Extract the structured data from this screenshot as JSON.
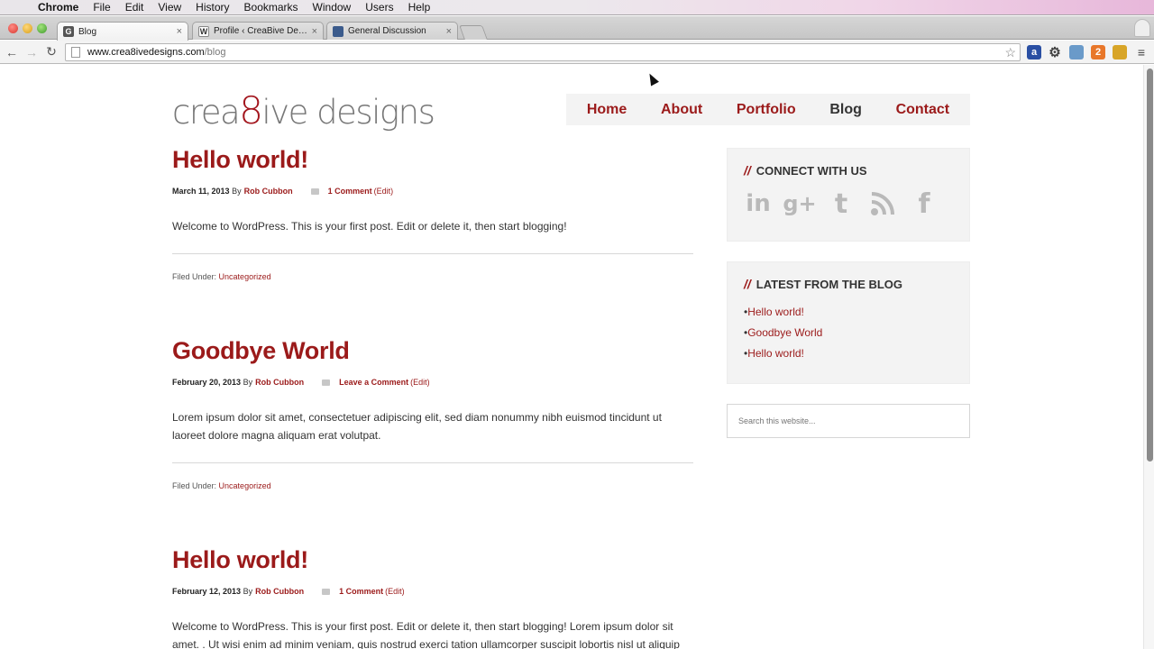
{
  "menubar": {
    "app": "Chrome",
    "items": [
      "File",
      "Edit",
      "View",
      "History",
      "Bookmarks",
      "Window",
      "Users",
      "Help"
    ]
  },
  "tabs": [
    {
      "label": "Blog",
      "favicon": "G",
      "active": true
    },
    {
      "label": "Profile ‹ CreaBive Designs",
      "favicon": "W",
      "active": false
    },
    {
      "label": "General Discussion",
      "favicon": "",
      "active": false
    }
  ],
  "address": {
    "host": "www.crea8ivedesigns.com",
    "path": "/blog"
  },
  "site": {
    "logo_prefix": "crea",
    "logo_eight": "8",
    "logo_suffix": "ive designs",
    "nav": [
      "Home",
      "About",
      "Portfolio",
      "Blog",
      "Contact"
    ]
  },
  "posts": [
    {
      "title": "Hello world!",
      "date": "March 11, 2013",
      "by": "By",
      "author": "Rob Cubbon",
      "comments": "1 Comment",
      "edit": "(Edit)",
      "excerpt": "Welcome to WordPress. This is your first post. Edit or delete it, then start blogging!",
      "filed_label": "Filed Under:",
      "category": "Uncategorized"
    },
    {
      "title": "Goodbye World",
      "date": "February 20, 2013",
      "by": "By",
      "author": "Rob Cubbon",
      "comments": "Leave a Comment",
      "edit": "(Edit)",
      "excerpt": "Lorem ipsum dolor sit amet, consectetuer adipiscing elit, sed diam nonummy nibh euismod tincidunt ut laoreet dolore magna aliquam erat volutpat.",
      "filed_label": "Filed Under:",
      "category": "Uncategorized"
    },
    {
      "title": "Hello world!",
      "date": "February 12, 2013",
      "by": "By",
      "author": "Rob Cubbon",
      "comments": "1 Comment",
      "edit": "(Edit)",
      "excerpt": "Welcome to WordPress. This is your first post. Edit or delete it, then start blogging! Lorem ipsum dolor sit amet. . Ut wisi enim ad minim veniam, quis nostrud exerci tation ullamcorper suscipit lobortis nisl ut aliquip",
      "filed_label": "",
      "category": ""
    }
  ],
  "sidebar": {
    "connect_title": "CONNECT WITH US",
    "social_icons": [
      "linkedin-icon",
      "google-plus-icon",
      "twitter-icon",
      "rss-icon",
      "facebook-icon"
    ],
    "latest_title": "LATEST FROM THE BLOG",
    "latest": [
      "Hello world!",
      "Goodbye World",
      "Hello world!"
    ],
    "search_placeholder": "Search this website..."
  },
  "colors": {
    "accent": "#9b1a1a",
    "nav_bg": "#f3f3f3"
  }
}
